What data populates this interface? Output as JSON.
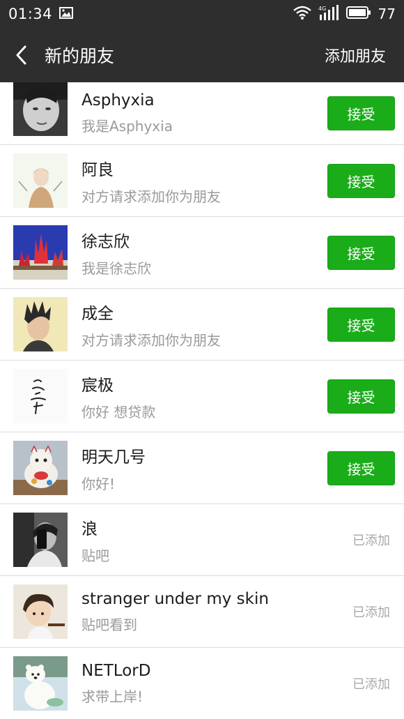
{
  "status_bar": {
    "time": "01:34",
    "battery": "77",
    "icons": [
      "image-icon",
      "wifi-icon",
      "signal-4g-icon",
      "battery-icon"
    ]
  },
  "header": {
    "title": "新的朋友",
    "action": "添加朋友",
    "back_icon": "back-arrow-icon"
  },
  "colors": {
    "bar": "#2e2e2e",
    "accept": "#1aad19"
  },
  "requests": [
    {
      "name": "Asphyxia",
      "message": "我是Asphyxia",
      "action": "接受",
      "added": false
    },
    {
      "name": "阿良",
      "message": "对方请求添加你为朋友",
      "action": "接受",
      "added": false
    },
    {
      "name": "徐志欣",
      "message": "我是徐志欣",
      "action": "接受",
      "added": false
    },
    {
      "name": "成全",
      "message": "对方请求添加你为朋友",
      "action": "接受",
      "added": false
    },
    {
      "name": "宸极",
      "message": "你好  想贷款",
      "action": "接受",
      "added": false
    },
    {
      "name": "明天几号",
      "message": "你好!",
      "action": "接受",
      "added": false
    },
    {
      "name": "浪",
      "message": "贴吧",
      "action": "已添加",
      "added": true
    },
    {
      "name": "stranger under my skin",
      "message": "贴吧看到",
      "action": "已添加",
      "added": true
    },
    {
      "name": "NETLorD",
      "message": "求带上岸!",
      "action": "已添加",
      "added": true
    }
  ]
}
